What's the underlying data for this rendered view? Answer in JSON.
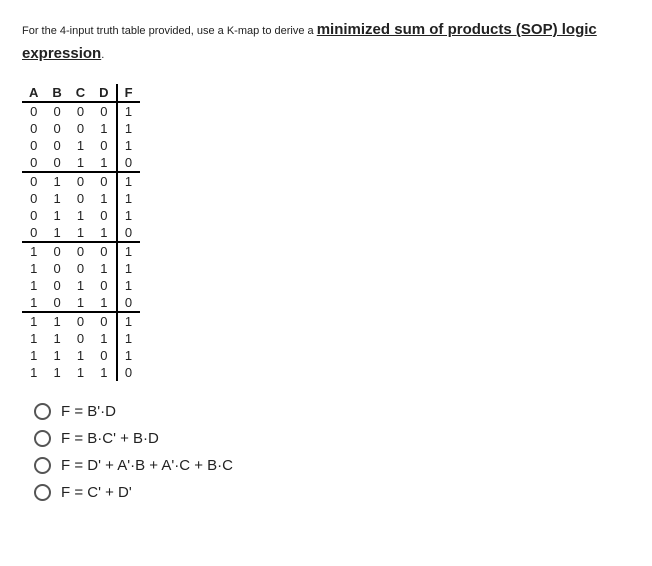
{
  "prompt": {
    "pre": "For the 4-input truth table provided, use a K-map to derive a ",
    "emph": "minimized sum of products (SOP) logic expression",
    "post": "."
  },
  "truth_table": {
    "headers": [
      "A",
      "B",
      "C",
      "D",
      "F"
    ],
    "rows": [
      [
        "0",
        "0",
        "0",
        "0",
        "1"
      ],
      [
        "0",
        "0",
        "0",
        "1",
        "1"
      ],
      [
        "0",
        "0",
        "1",
        "0",
        "1"
      ],
      [
        "0",
        "0",
        "1",
        "1",
        "0"
      ],
      [
        "0",
        "1",
        "0",
        "0",
        "1"
      ],
      [
        "0",
        "1",
        "0",
        "1",
        "1"
      ],
      [
        "0",
        "1",
        "1",
        "0",
        "1"
      ],
      [
        "0",
        "1",
        "1",
        "1",
        "0"
      ],
      [
        "1",
        "0",
        "0",
        "0",
        "1"
      ],
      [
        "1",
        "0",
        "0",
        "1",
        "1"
      ],
      [
        "1",
        "0",
        "1",
        "0",
        "1"
      ],
      [
        "1",
        "0",
        "1",
        "1",
        "0"
      ],
      [
        "1",
        "1",
        "0",
        "0",
        "1"
      ],
      [
        "1",
        "1",
        "0",
        "1",
        "1"
      ],
      [
        "1",
        "1",
        "1",
        "0",
        "1"
      ],
      [
        "1",
        "1",
        "1",
        "1",
        "0"
      ]
    ]
  },
  "choices": {
    "a": "F = B'·D",
    "b": "F = B·C' + B·D",
    "c": "F = D' + A'·B + A'·C + B·C",
    "d": "F = C' + D'"
  }
}
